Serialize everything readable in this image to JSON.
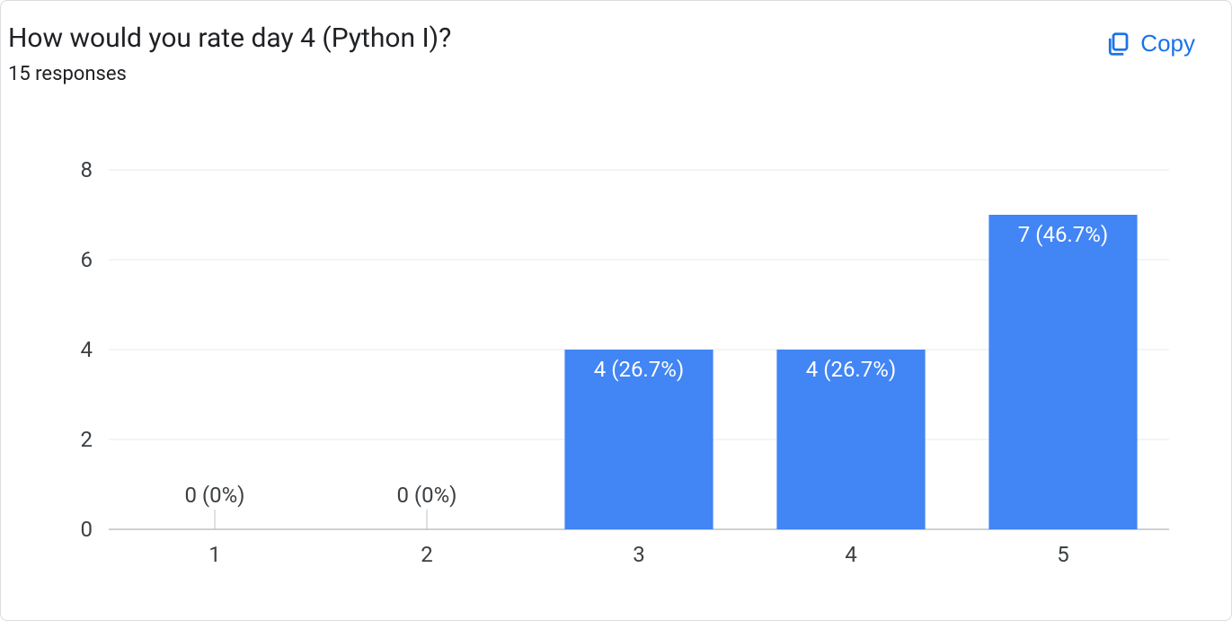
{
  "header": {
    "title": "How would you rate day 4 (Python I)?",
    "responses": "15 responses",
    "copy_label": "Copy"
  },
  "chart_data": {
    "type": "bar",
    "categories": [
      "1",
      "2",
      "3",
      "4",
      "5"
    ],
    "values": [
      0,
      0,
      4,
      4,
      7
    ],
    "labels": [
      "0 (0%)",
      "0 (0%)",
      "4 (26.7%)",
      "4 (26.7%)",
      "7 (46.7%)"
    ],
    "ylim": [
      0,
      8
    ],
    "yticks": [
      0,
      2,
      4,
      6,
      8
    ],
    "bar_color": "#4285f4",
    "title": "",
    "xlabel": "",
    "ylabel": ""
  }
}
